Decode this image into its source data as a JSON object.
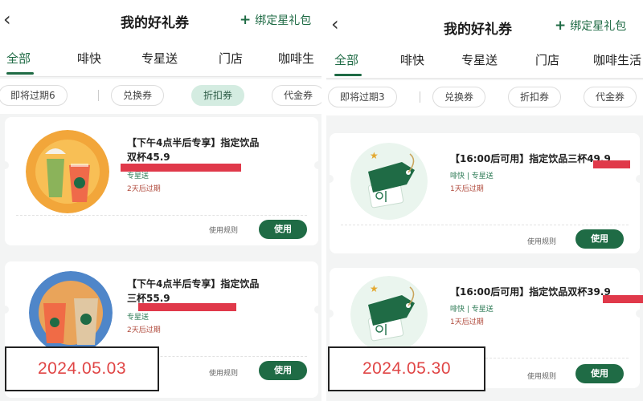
{
  "left": {
    "title": "我的好礼券",
    "bind_link": "绑定星礼包",
    "tabs": [
      "全部",
      "啡快",
      "专星送",
      "门店",
      "咖啡生"
    ],
    "filters": [
      "即将过期6",
      "兑换券",
      "折扣券",
      "代金券"
    ],
    "coupons": [
      {
        "title_line1": "【下午4点半后专享】指定饮品",
        "title_line2": "双杯45.9",
        "channel": "专星送",
        "expire": "2天后过期",
        "rules": "使用规则",
        "button": "使用"
      },
      {
        "title_line1": "【下午4点半后专享】指定饮品",
        "title_line2": "三杯55.9",
        "channel": "专星送",
        "expire": "2天后过期",
        "rules": "使用规则",
        "button": "使用"
      }
    ],
    "date_stamp": "2024.05.03"
  },
  "right": {
    "title": "我的好礼券",
    "bind_link": "绑定星礼包",
    "tabs": [
      "全部",
      "啡快",
      "专星送",
      "门店",
      "咖啡生活"
    ],
    "filters": [
      "即将过期3",
      "兑换券",
      "折扣券",
      "代金券"
    ],
    "coupons": [
      {
        "title_line1": "【16:00后可用】指定饮品三杯49.9",
        "channel": "啡快 | 专星送",
        "expire": "1天后过期",
        "rules": "使用规则",
        "button": "使用"
      },
      {
        "title_line1": "【16:00后可用】指定饮品双杯39.9",
        "channel": "啡快 | 专星送",
        "expire": "1天后过期",
        "rules": "使用规则",
        "button": "使用"
      }
    ],
    "date_stamp": "2024.05.30"
  },
  "icons": {
    "back": "chevron-left-icon",
    "plus": "plus-icon",
    "coupon_thumb_drinks": "drink-cups-icon",
    "coupon_thumb_tag": "price-tag-icon"
  },
  "colors": {
    "brand_green": "#1f6b45",
    "chip_active_bg": "#d4ece1",
    "expire_red": "#b04a3c",
    "date_red": "#e04545",
    "redact_red": "#e0394a"
  }
}
